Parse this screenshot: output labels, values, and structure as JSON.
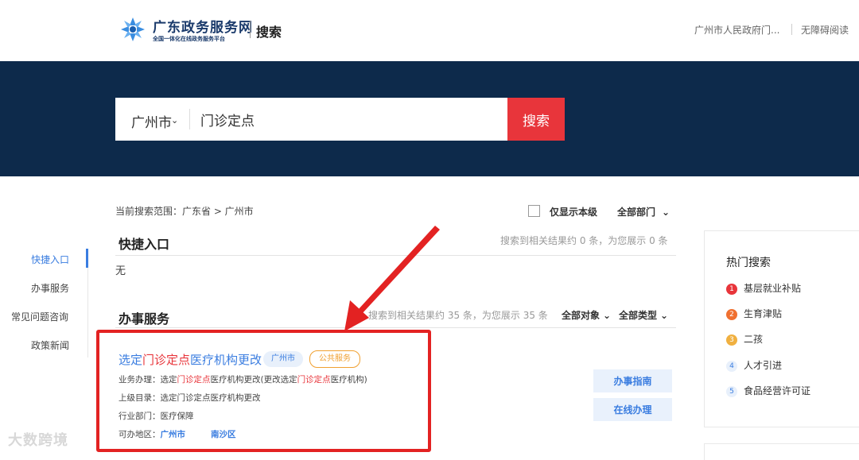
{
  "header": {
    "brand_title": "广东政务服务网",
    "brand_subtitle": "全国一体化在线政务服务平台",
    "page_name": "搜索",
    "gov_link": "广州市人民政府门...",
    "accessibility_link": "无障碍阅读",
    "icons": [
      "logo-flower-icon"
    ],
    "colors": {
      "header_text": "#1a3a6b"
    }
  },
  "search": {
    "city": "广州市",
    "query": "门诊定点",
    "button": "搜索",
    "colors": {
      "banner": "#0d2a4b",
      "button": "#e8353b"
    }
  },
  "left_nav": {
    "items": [
      {
        "label": "快捷入口",
        "active": true
      },
      {
        "label": "办事服务",
        "active": false
      },
      {
        "label": "常见问题咨询",
        "active": false
      },
      {
        "label": "政策新闻",
        "active": false
      }
    ]
  },
  "scope": {
    "text": "当前搜索范围：广东省 > 广州市",
    "only_level_label": "仅显示本级",
    "dept_filter": "全部部门"
  },
  "quick_entry": {
    "title": "快捷入口",
    "count_text": "搜索到相关结果约 0 条，为您展示 0 条",
    "empty_text": "无"
  },
  "services": {
    "title": "办事服务",
    "count_text": "搜索到相关结果约 35 条，为您展示 35 条",
    "object_filter": "全部对象",
    "type_filter": "全部类型",
    "result": {
      "title_pre": "选定",
      "title_hl": "门诊定点",
      "title_post": "医疗机构更改",
      "region_tag": "广州市",
      "service_tag": "公共服务",
      "business_label": "业务办理：选定",
      "business_hl1": "门诊定点",
      "business_mid": "医疗机构更改(更改选定",
      "business_hl2": "门诊定点",
      "business_end": "医疗机构)",
      "parent_dir": "上级目录：选定门诊定点医疗机构更改",
      "department": "行业部门：医疗保障",
      "area_label": "可办地区：",
      "area_1": "广州市",
      "area_2": "南沙区",
      "guide_button": "办事指南",
      "online_button": "在线办理"
    }
  },
  "hot_search": {
    "title": "热门搜索",
    "items": [
      {
        "rank": "1",
        "label": "基层就业补贴",
        "color": "#e8353b"
      },
      {
        "rank": "2",
        "label": "生育津贴",
        "color": "#f07030"
      },
      {
        "rank": "3",
        "label": "二孩",
        "color": "#f0b040"
      },
      {
        "rank": "4",
        "label": "人才引进",
        "color": "#e8f0fb"
      },
      {
        "rank": "5",
        "label": "食品经营许可证",
        "color": "#e8f0fb"
      }
    ]
  },
  "watermark": "大数跨境"
}
